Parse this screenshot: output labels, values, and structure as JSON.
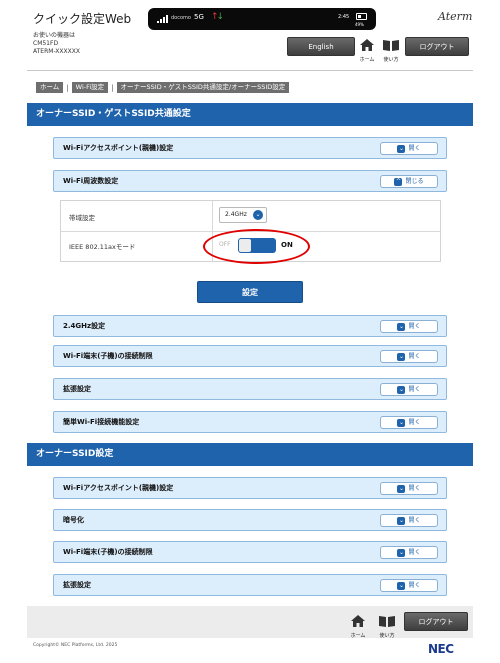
{
  "header": {
    "app_title": "クイック設定Web",
    "device_line1": "お使いの機器は",
    "device_line2": "CM51FD",
    "device_line3": "ATERM-XXXXXX",
    "brand": "Aterm",
    "english_label": "English",
    "home_label": "ホーム",
    "guide_label": "使い方",
    "logout_label": "ログアウト"
  },
  "statusbar": {
    "carrier": "docomo",
    "network": "5G",
    "time": "2:45",
    "battery_pct": "49%",
    "battery_level": 0.49,
    "up_color": "#e53935",
    "down_color": "#43a047"
  },
  "breadcrumb": [
    "ホーム",
    "Wi-Fi設定",
    "オーナーSSID・ゲストSSID共通設定/オーナーSSID設定"
  ],
  "section1": {
    "title": "オーナーSSID・ゲストSSID共通設定",
    "rows": [
      {
        "label": "Wi-Fiアクセスポイント(親機)設定",
        "button": "開く"
      },
      {
        "label": "Wi-Fi周波数設定",
        "button": "閉じる"
      }
    ],
    "panel": {
      "band_label": "帯域設定",
      "band_value": "2.4GHz",
      "ax_label": "IEEE 802.11axモード",
      "toggle_off": "OFF",
      "toggle_on": "ON",
      "toggle_state": "on"
    },
    "submit_label": "設定",
    "rows_after": [
      {
        "label": "2.4GHz設定",
        "button": "開く"
      },
      {
        "label": "Wi-Fi端末(子機)の接続制限",
        "button": "開く"
      },
      {
        "label": "拡張設定",
        "button": "開く"
      },
      {
        "label": "簡単Wi-Fi接続機能設定",
        "button": "開く"
      }
    ]
  },
  "section2": {
    "title": "オーナーSSID設定",
    "rows": [
      {
        "label": "Wi-Fiアクセスポイント(親機)設定",
        "button": "開く"
      },
      {
        "label": "暗号化",
        "button": "開く"
      },
      {
        "label": "Wi-Fi端末(子機)の接続制限",
        "button": "開く"
      },
      {
        "label": "拡張設定",
        "button": "開く"
      }
    ]
  },
  "footer": {
    "home_label": "ホーム",
    "guide_label": "使い方",
    "logout_label": "ログアウト",
    "copyright": "Copyright© NEC Platforms, Ltd. 2025",
    "logo": "NEC"
  },
  "colors": {
    "accent": "#1f63ac",
    "row_bg": "#dcedfb",
    "highlight": "#e00000"
  }
}
